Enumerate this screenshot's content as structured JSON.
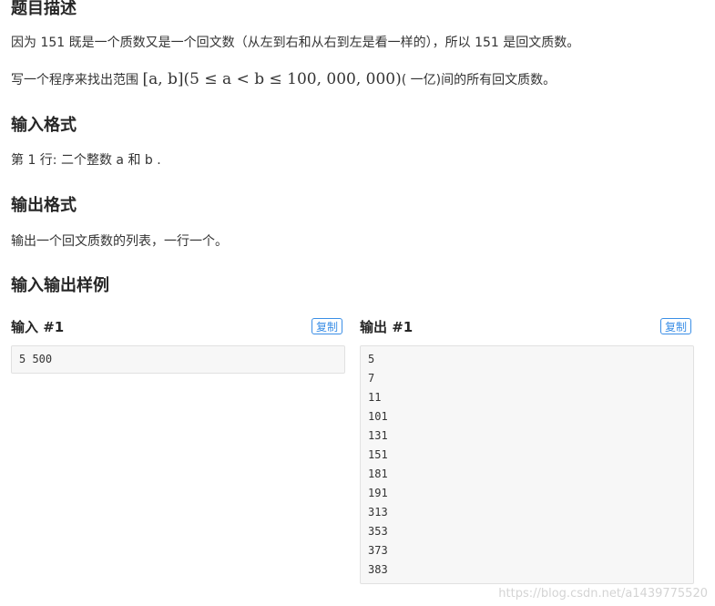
{
  "sections": {
    "description_title": "题目描述",
    "description_p1": "因为 151 既是一个质数又是一个回文数（从左到右和从右到左是看一样的），所以 151 是回文质数。",
    "description_p2_before": "写一个程序来找出范围 ",
    "description_p2_math": "[a, b](5 ≤ a < b ≤ 100, 000, 000)",
    "description_p2_after": "( 一亿)间的所有回文质数。",
    "input_title": "输入格式",
    "input_text": "第 1 行: 二个整数 a 和 b .",
    "output_title": "输出格式",
    "output_text": "输出一个回文质数的列表，一行一个。",
    "samples_title": "输入输出样例"
  },
  "sample": {
    "input_label": "输入 #1",
    "output_label": "输出 #1",
    "copy_label": "复制",
    "input_lines": [
      "5 500"
    ],
    "output_lines": [
      "5",
      "7",
      "11",
      "101",
      "131",
      "151",
      "181",
      "191",
      "313",
      "353",
      "373",
      "383"
    ]
  },
  "watermark": "https://blog.csdn.net/a1439775520"
}
